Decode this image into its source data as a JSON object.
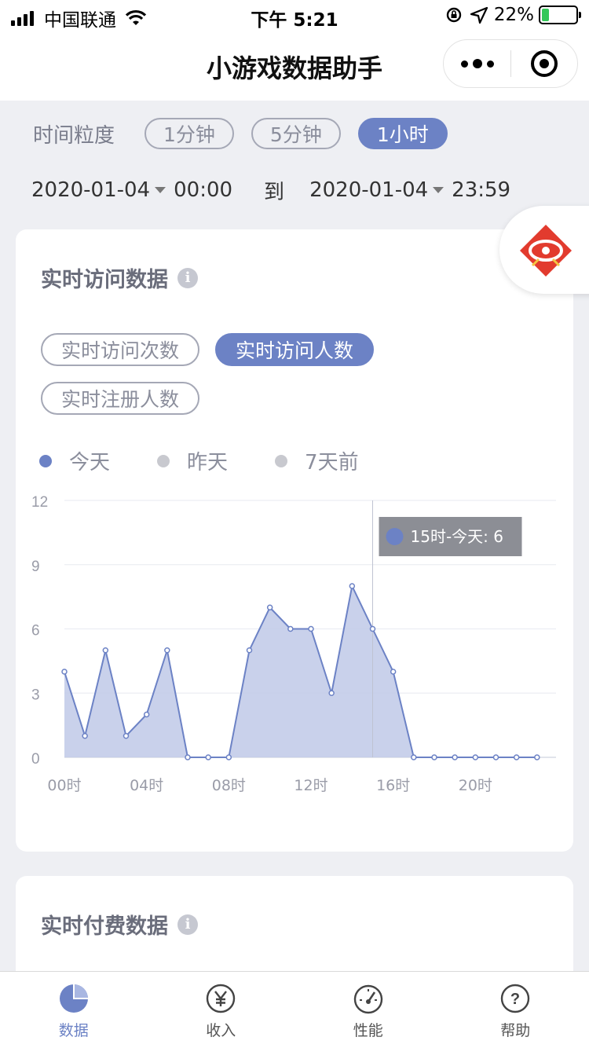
{
  "status_bar": {
    "carrier": "中国联通",
    "time": "下午 5:21",
    "battery": "22%",
    "battery_level": 0.22
  },
  "nav": {
    "title": "小游戏数据助手",
    "menu_icon": "more-dots-icon",
    "close_icon": "target-circle-icon"
  },
  "granularity": {
    "label": "时间粒度",
    "options": [
      "1分钟",
      "5分钟",
      "1小时"
    ],
    "selected": "1小时"
  },
  "date_range": {
    "start_date": "2020-01-04",
    "start_time": "00:00",
    "to": "到",
    "end_date": "2020-01-04",
    "end_time": "23:59"
  },
  "realtime_visit": {
    "title": "实时访问数据",
    "info_icon": "i",
    "metrics": [
      "实时访问次数",
      "实时访问人数",
      "实时注册人数"
    ],
    "selected_metric": "实时访问人数",
    "legend": [
      {
        "label": "今天",
        "color": "#6c82c5"
      },
      {
        "label": "昨天",
        "color": "#c8c9cf"
      },
      {
        "label": "7天前",
        "color": "#c8c9cf"
      }
    ],
    "tooltip": "15时-今天: 6"
  },
  "chart_data": {
    "type": "area",
    "title": "",
    "x": [
      "00时",
      "01时",
      "02时",
      "03时",
      "04时",
      "05时",
      "06时",
      "07时",
      "08时",
      "09时",
      "10时",
      "11时",
      "12时",
      "13时",
      "14时",
      "15时",
      "16时",
      "17时",
      "18时",
      "19时",
      "20时",
      "21时",
      "22时",
      "23时"
    ],
    "x_tick_labels": [
      "00时",
      "04时",
      "08时",
      "12时",
      "16时",
      "20时"
    ],
    "y_ticks": [
      0,
      3,
      6,
      9,
      12
    ],
    "ylim": [
      0,
      12
    ],
    "series": [
      {
        "name": "今天",
        "values": [
          4,
          1,
          5,
          1,
          2,
          5,
          0,
          0,
          0,
          5,
          7,
          6,
          6,
          3,
          8,
          6,
          4,
          0,
          0,
          0,
          0,
          0,
          0,
          0
        ]
      }
    ],
    "highlight_index": 15,
    "grid": true,
    "colors": {
      "line": "#6c82c5",
      "fill": "#c3cce9"
    }
  },
  "realtime_pay": {
    "title": "实时付费数据",
    "info_icon": "i"
  },
  "tab_bar": [
    {
      "label": "数据",
      "icon": "pie-chart-icon",
      "active": true
    },
    {
      "label": "收入",
      "icon": "yen-icon",
      "active": false
    },
    {
      "label": "性能",
      "icon": "gauge-icon",
      "active": false
    },
    {
      "label": "帮助",
      "icon": "help-icon",
      "active": false
    }
  ]
}
